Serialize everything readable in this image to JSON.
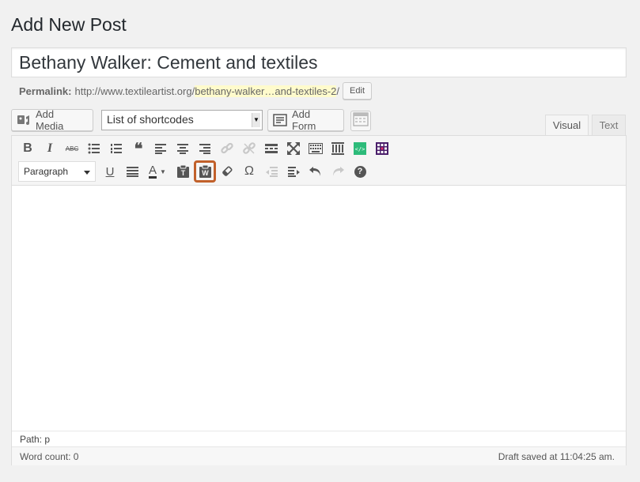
{
  "page": {
    "title": "Add New Post"
  },
  "post": {
    "title_value": "Bethany Walker: Cement and textiles"
  },
  "permalink": {
    "label": "Permalink:",
    "base": "http://www.textileartist.org/",
    "slug": "bethany-walker…and-textiles-2",
    "trail": "/",
    "edit_label": "Edit"
  },
  "media_bar": {
    "add_media_label": "Add Media",
    "shortcodes_selected": "List of shortcodes",
    "add_form_label": "Add Form"
  },
  "tabs": {
    "visual": "Visual",
    "text": "Text"
  },
  "toolbar": {
    "format_selected": "Paragraph",
    "highlight_color": "#c1602a",
    "row1_icons": [
      "bold-icon",
      "italic-icon",
      "strikethrough-icon",
      "bullet-list-icon",
      "numbered-list-icon",
      "blockquote-icon",
      "align-left-icon",
      "align-center-icon",
      "align-right-icon",
      "link-icon",
      "unlink-icon",
      "read-more-icon",
      "fullscreen-icon",
      "toolbar-toggle-icon",
      "columns-icon",
      "code-embed-icon",
      "grid-plugin-icon"
    ],
    "row2_icons": [
      "format-select",
      "underline-icon",
      "justify-icon",
      "text-color-icon",
      "paste-text-icon",
      "paste-from-word-icon",
      "clear-formatting-icon",
      "special-character-icon",
      "outdent-icon",
      "indent-icon",
      "undo-icon",
      "redo-icon",
      "help-icon"
    ],
    "bold": "B",
    "italic": "I",
    "strike": "ABC",
    "quote": "❝",
    "underline": "U",
    "text_color": "A",
    "omega": "Ω",
    "help": "?"
  },
  "editor": {
    "path_label": "Path: p",
    "word_count": "Word count: 0",
    "draft_status": "Draft saved at 11:04:25 am."
  }
}
